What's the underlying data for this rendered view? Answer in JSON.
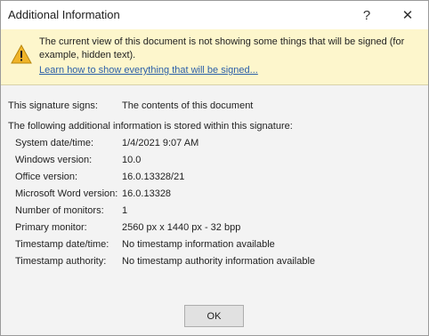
{
  "window": {
    "title": "Additional Information",
    "help_glyph": "?",
    "close_glyph": "✕"
  },
  "banner": {
    "icon": "warning-icon",
    "message": "The current view of this document is not showing some things that will be signed (for example, hidden text).",
    "link": "Learn how to show everything that will be signed..."
  },
  "signs": {
    "label": "This signature signs:",
    "value": "The contents of this document"
  },
  "info": {
    "heading": "The following additional information is stored within this signature:",
    "rows": [
      {
        "label": "System date/time:",
        "value": "1/4/2021 9:07 AM"
      },
      {
        "label": "Windows version:",
        "value": "10.0"
      },
      {
        "label": "Office version:",
        "value": "16.0.13328/21"
      },
      {
        "label": "Microsoft Word version:",
        "value": "16.0.13328"
      },
      {
        "label": "Number of monitors:",
        "value": "1"
      },
      {
        "label": "Primary monitor:",
        "value": "2560 px x 1440 px - 32 bpp"
      },
      {
        "label": "Timestamp date/time:",
        "value": "No timestamp information available"
      },
      {
        "label": "Timestamp authority:",
        "value": "No timestamp authority information available"
      }
    ]
  },
  "buttons": {
    "ok": "OK"
  },
  "colors": {
    "banner_bg": "#fdf6cc",
    "warning_fill": "#f0b429",
    "link": "#2b5fa8",
    "dialog_bg": "#f3f3f3"
  }
}
